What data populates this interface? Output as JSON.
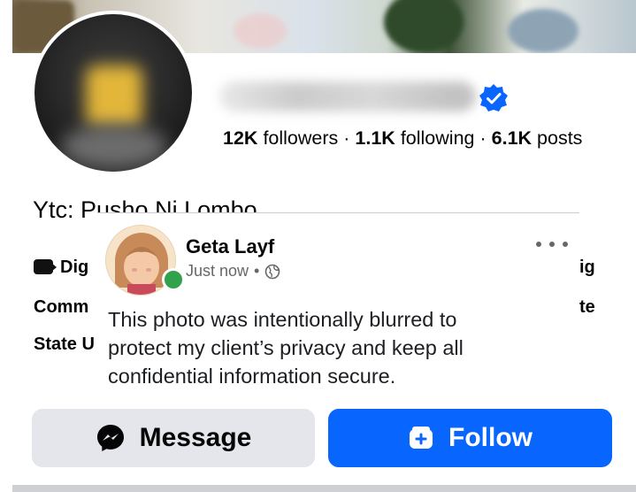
{
  "profile": {
    "followers_count": "12K",
    "followers_label": "followers",
    "following_count": "1.1K",
    "following_label": "following",
    "posts_count": "6.1K",
    "posts_label": "posts",
    "separator": "·",
    "bio_partial": "Ytc: Pusho Ni Lombo",
    "info_left": [
      "Dig",
      "Comm",
      "State U"
    ],
    "info_right": [
      "ig",
      "te"
    ]
  },
  "post": {
    "author": "Geta Layf",
    "time": "Just now",
    "meta_separator": "•",
    "text": "This photo was intentionally blurred to protect my client’s privacy and keep all confidential information secure."
  },
  "actions": {
    "message_label": "Message",
    "follow_label": "Follow"
  },
  "colors": {
    "follow_blue": "#0866ff",
    "verified_blue": "#0866ff",
    "online_green": "#31a24c",
    "message_gray": "#e4e6eb"
  }
}
